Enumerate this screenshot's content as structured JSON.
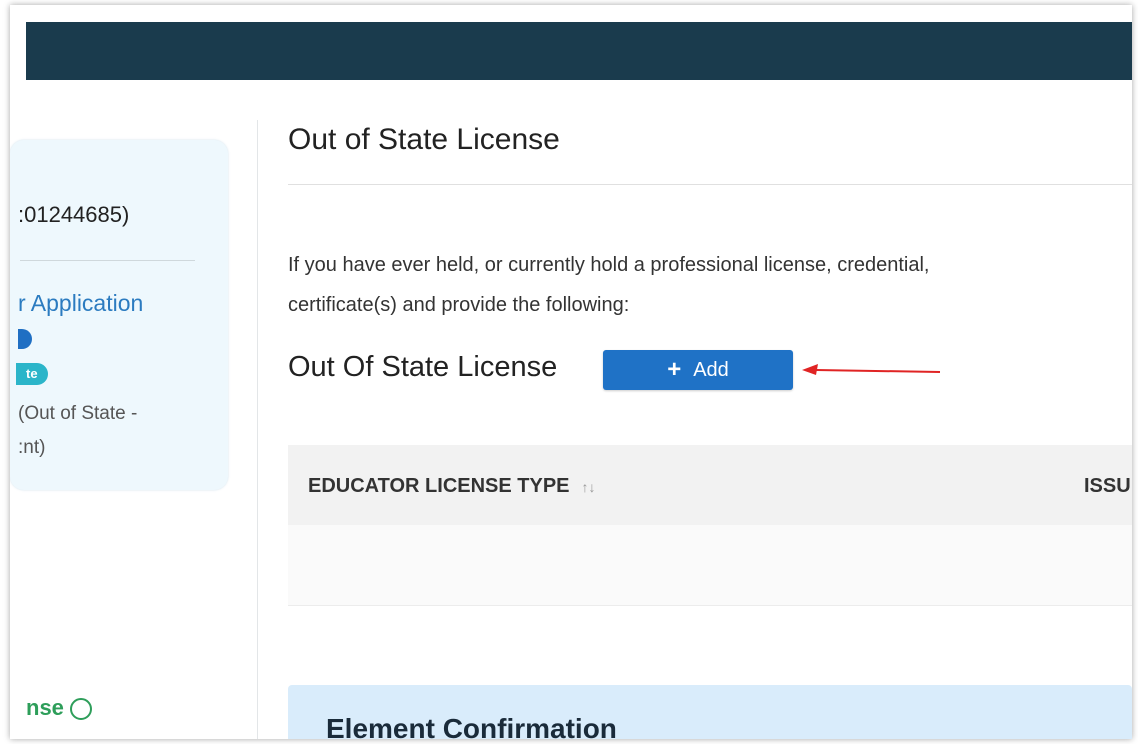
{
  "sidebar": {
    "app_number": ":01244685)",
    "app_link": "r Application",
    "status_badge": "te",
    "app_type_line1": "(Out of State -",
    "app_type_line2": ":nt)",
    "license_step": "nse"
  },
  "main": {
    "page_title": "Out of State License",
    "instructions_line1": "If you have ever held, or currently hold a professional license, credential,",
    "instructions_line2": "certificate(s) and provide the following:",
    "section_heading": "Out Of State License",
    "add_button_label": "Add",
    "table": {
      "columns": [
        "EDUCATOR LICENSE TYPE",
        "ISSU"
      ],
      "sort_icon": "↑↓"
    },
    "confirmation_title": "Element Confirmation"
  },
  "colors": {
    "topbar": "#1a3b4d",
    "primary_button": "#1f72c6",
    "link": "#2b7bc0",
    "success": "#2e9e5a",
    "annotation_arrow": "#e02424"
  }
}
